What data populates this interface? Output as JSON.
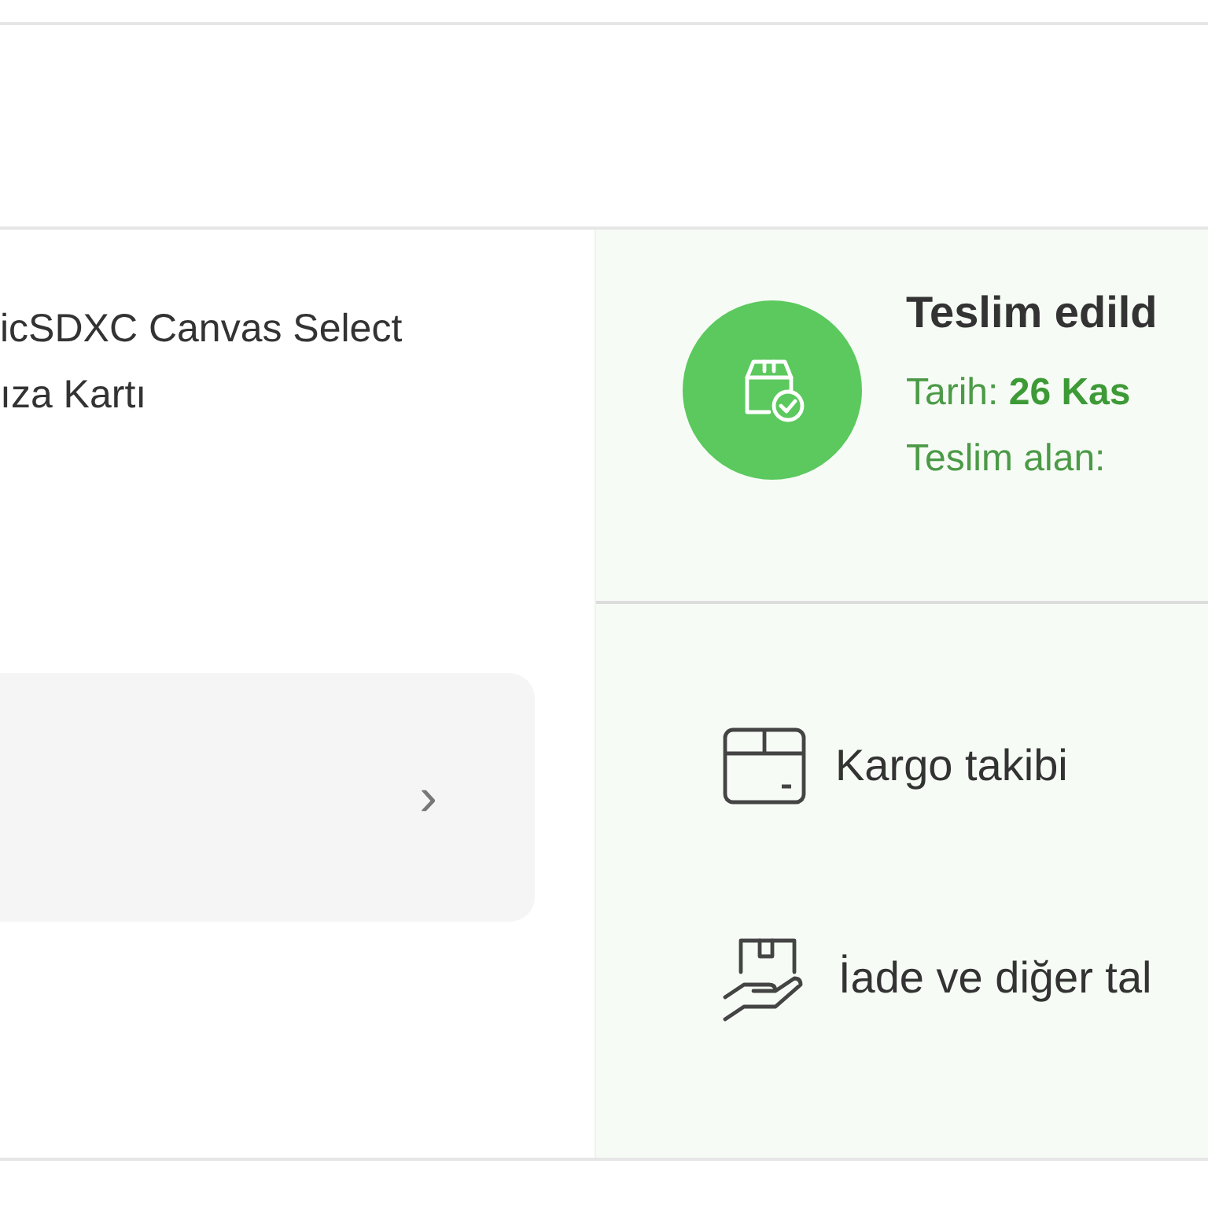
{
  "product": {
    "name_lines": [
      "icSDXC Canvas Select",
      "ıza Kartı"
    ]
  },
  "detail_card": {
    "chevron": "›"
  },
  "delivery": {
    "status": "Teslim edild",
    "date_label": "Tarih:",
    "date_value": "26 Kas",
    "receiver_label": "Teslim alan:"
  },
  "actions": [
    {
      "kind": "box",
      "label": "Kargo takibi"
    },
    {
      "kind": "return",
      "label": "İade ve diğer tal"
    }
  ]
}
